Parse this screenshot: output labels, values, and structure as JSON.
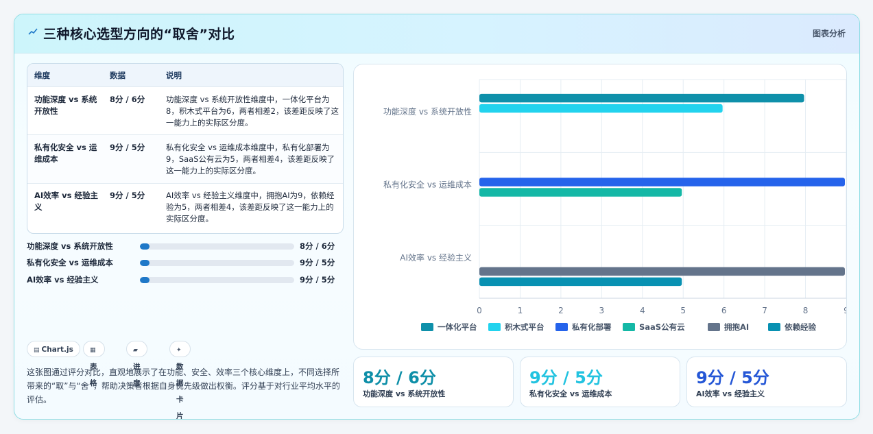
{
  "header": {
    "title": "三种核心选型方向的“取舍”对比",
    "tag": "图表分析"
  },
  "table": {
    "headers": [
      "维度",
      "数据",
      "说明"
    ],
    "rows": [
      {
        "dimension": "功能深度 vs 系统开放性",
        "data": "8分 / 6分",
        "note": "功能深度 vs 系统开放性维度中，一体化平台为8，积木式平台为6，两者相差2，该差距反映了这一能力上的实际区分度。"
      },
      {
        "dimension": "私有化安全 vs 运维成本",
        "data": "9分 / 5分",
        "note": "私有化安全 vs 运维成本维度中，私有化部署为9，SaaS公有云为5，两者相差4，该差距反映了这一能力上的实际区分度。"
      },
      {
        "dimension": "AI效率 vs 经验主义",
        "data": "9分 / 5分",
        "note": "AI效率 vs 经验主义维度中，拥抱AI为9，依赖经验为5，两者相差4，该差距反映了这一能力上的实际区分度。"
      }
    ]
  },
  "progress": [
    {
      "label": "功能深度 vs 系统开放性",
      "value": "8分 / 6分",
      "fraction": 0.06
    },
    {
      "label": "私有化安全 vs 运维成本",
      "value": "9分 / 5分",
      "fraction": 0.06
    },
    {
      "label": "AI效率 vs 经验主义",
      "value": "9分 / 5分",
      "fraction": 0.06
    }
  ],
  "chips": [
    {
      "icon": "▤",
      "label": "Chart.js",
      "icon_name": "chart-icon"
    },
    {
      "icon": "▦",
      "label": "表格",
      "icon_name": "table-icon"
    },
    {
      "icon": "▰",
      "label": "进度",
      "icon_name": "progress-icon"
    },
    {
      "icon": "✦",
      "label": "数据卡片",
      "icon_name": "sparkle-icon"
    }
  ],
  "description": "这张图通过评分对比，直观地展示了在功能、安全、效率三个核心维度上，不同选择所带来的“取”与“舍”，帮助决策者根据自身优先级做出权衡。评分基于对行业平均水平的评估。",
  "stats": [
    {
      "value": "8分 / 6分",
      "label": "功能深度 vs 系统开放性",
      "color": "#0e8fa8"
    },
    {
      "value": "9分 / 5分",
      "label": "私有化安全 vs 运维成本",
      "color": "#22c3e0"
    },
    {
      "value": "9分 / 5分",
      "label": "AI效率 vs 经验主义",
      "color": "#2557d6"
    }
  ],
  "chart_data": {
    "type": "bar",
    "orientation": "horizontal",
    "categories": [
      "功能深度 vs 系统开放性",
      "私有化安全 vs 运维成本",
      "AI效率 vs 经验主义"
    ],
    "xlim": [
      0,
      9
    ],
    "xticks": [
      0,
      1,
      2,
      3,
      4,
      5,
      6,
      7,
      8,
      9
    ],
    "grid": true,
    "legend_position": "bottom",
    "series": [
      {
        "name": "一体化平台",
        "color": "#0e90aa",
        "values": [
          8,
          null,
          null
        ]
      },
      {
        "name": "积木式平台",
        "color": "#22d3ee",
        "values": [
          6,
          null,
          null
        ]
      },
      {
        "name": "私有化部署",
        "color": "#2563eb",
        "values": [
          null,
          9,
          null
        ]
      },
      {
        "name": "SaaS公有云",
        "color": "#14b8a6",
        "values": [
          null,
          5,
          null
        ]
      },
      {
        "name": "拥抱AI",
        "color": "#64748b",
        "values": [
          null,
          null,
          9
        ]
      },
      {
        "name": "依赖经验",
        "color": "#0891b2",
        "values": [
          null,
          null,
          5
        ]
      }
    ]
  }
}
